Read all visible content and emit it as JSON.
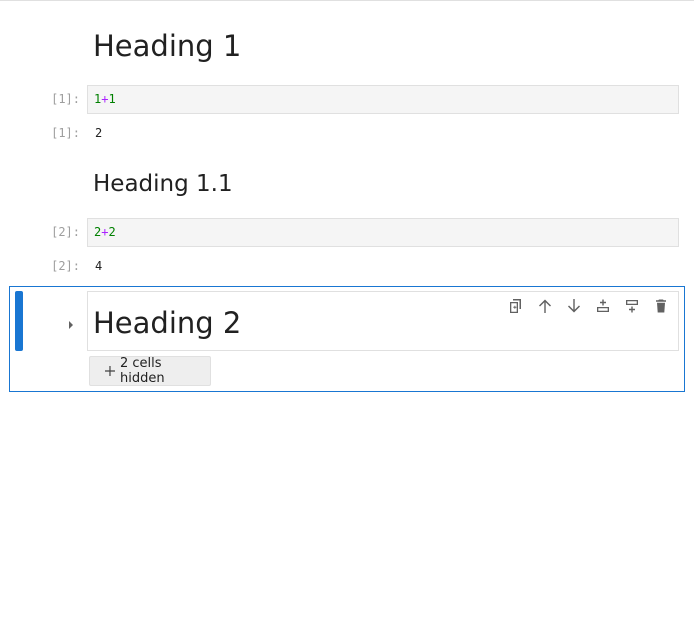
{
  "cells": {
    "heading1": {
      "text": "Heading 1"
    },
    "code1": {
      "prompt": "[1]:",
      "src": {
        "a": "1",
        "op": "+",
        "b": "1"
      },
      "out_prompt": "[1]:",
      "output": "2"
    },
    "heading11": {
      "text": "Heading 1.1"
    },
    "code2": {
      "prompt": "[2]:",
      "src": {
        "a": "2",
        "op": "+",
        "b": "2"
      },
      "out_prompt": "[2]:",
      "output": "4"
    },
    "heading2": {
      "text": "Heading 2",
      "hidden_label": "2 cells hidden"
    }
  },
  "toolbar": {
    "icons": [
      "duplicate-icon",
      "move-up-icon",
      "move-down-icon",
      "insert-above-icon",
      "insert-below-icon",
      "delete-icon"
    ]
  },
  "colors": {
    "accent": "#1976d2",
    "number": "#008000",
    "operator": "#aa22ff"
  }
}
